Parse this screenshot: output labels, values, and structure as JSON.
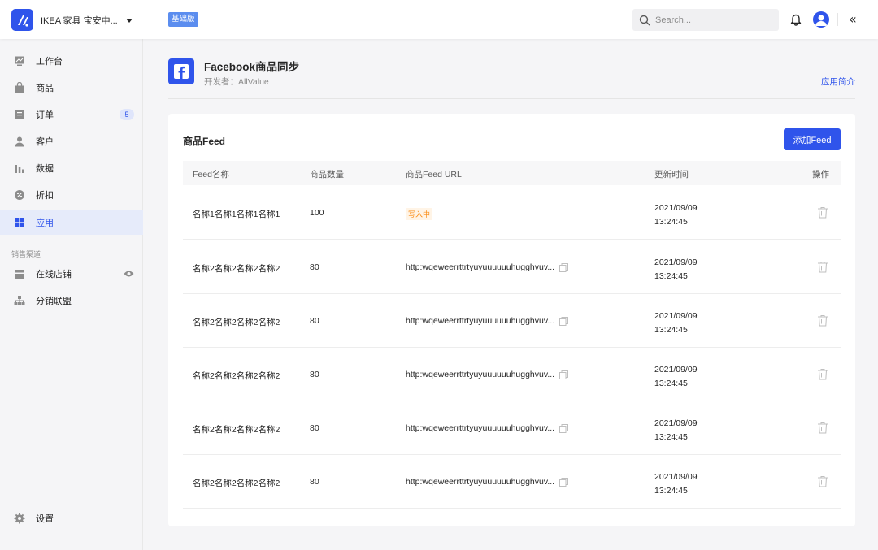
{
  "header": {
    "store_name": "IKEA 家具 宝安中...",
    "plan_badge": "基础版",
    "search_placeholder": "Search...",
    "collapse_glyph": "«"
  },
  "sidebar": {
    "items": [
      {
        "label": "工作台",
        "icon": "dashboard-icon"
      },
      {
        "label": "商品",
        "icon": "bag-icon"
      },
      {
        "label": "订单",
        "icon": "order-icon",
        "badge": "5"
      },
      {
        "label": "客户",
        "icon": "user-icon"
      },
      {
        "label": "数据",
        "icon": "bar-chart-icon"
      },
      {
        "label": "折扣",
        "icon": "discount-icon"
      },
      {
        "label": "应用",
        "icon": "apps-icon",
        "active": true
      }
    ],
    "section_title": "销售渠道",
    "channels": [
      {
        "label": "在线店铺",
        "icon": "store-icon"
      },
      {
        "label": "分销联盟",
        "icon": "network-icon"
      }
    ],
    "settings_label": "设置"
  },
  "app": {
    "title": "Facebook商品同步",
    "developer": "开发者：AllValue",
    "intro_link": "应用简介"
  },
  "feed": {
    "title": "商品Feed",
    "add_button": "添加Feed",
    "columns": [
      "Feed名称",
      "商品数量",
      "商品Feed URL",
      "更新时间",
      "操作"
    ],
    "rows": [
      {
        "name": "名称1名称1名称1名称1",
        "count": "100",
        "status": "写入中",
        "url": "",
        "date": "2021/09/09",
        "time": "13:24:45"
      },
      {
        "name": "名称2名称2名称2名称2",
        "count": "80",
        "status": "",
        "url": "http:wqeweerrttrtyuyuuuuuuhugghvuv...",
        "date": "2021/09/09",
        "time": "13:24:45"
      },
      {
        "name": "名称2名称2名称2名称2",
        "count": "80",
        "status": "",
        "url": "http:wqeweerrttrtyuyuuuuuuhugghvuv...",
        "date": "2021/09/09",
        "time": "13:24:45"
      },
      {
        "name": "名称2名称2名称2名称2",
        "count": "80",
        "status": "",
        "url": "http:wqeweerrttrtyuyuuuuuuhugghvuv...",
        "date": "2021/09/09",
        "time": "13:24:45"
      },
      {
        "name": "名称2名称2名称2名称2",
        "count": "80",
        "status": "",
        "url": "http:wqeweerrttrtyuyuuuuuuhugghvuv...",
        "date": "2021/09/09",
        "time": "13:24:45"
      },
      {
        "name": "名称2名称2名称2名称2",
        "count": "80",
        "status": "",
        "url": "http:wqeweerrttrtyuyuuuuuuhugghvuv...",
        "date": "2021/09/09",
        "time": "13:24:45"
      }
    ]
  },
  "colors": {
    "primary": "#2f54eb",
    "plan_badge": "#5b8def",
    "status_writing_text": "#fa8c16",
    "status_writing_bg": "#fff4e6",
    "active_nav_bg": "#e6ebfa"
  }
}
